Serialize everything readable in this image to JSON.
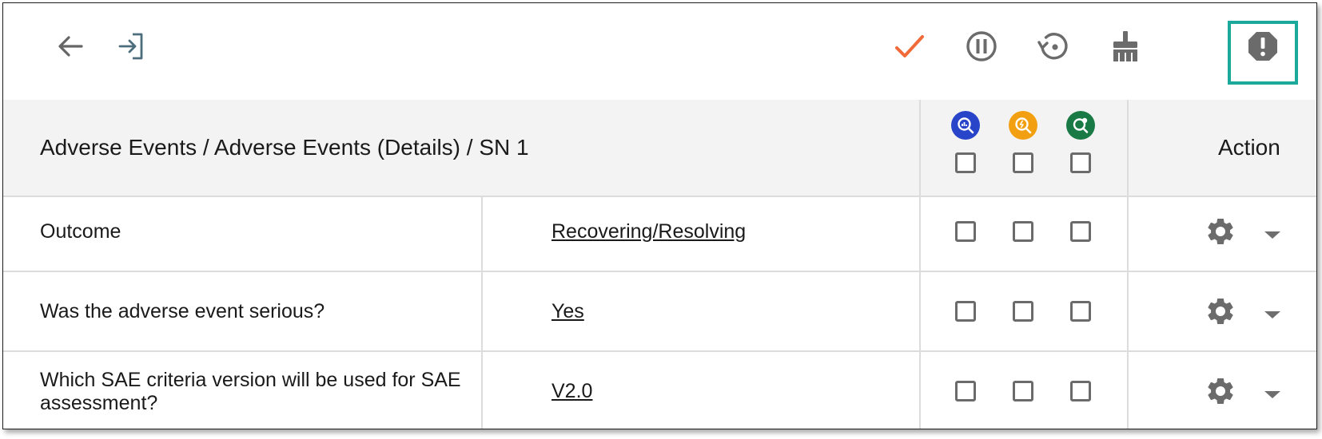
{
  "toolbar": {
    "icons": [
      "back-arrow-icon",
      "login-icon",
      "checkmark-icon",
      "pause-circle-icon",
      "restore-icon",
      "broom-icon",
      "alert-octagon-icon"
    ],
    "check_color": "#f06a3a",
    "highlight_color": "#1aa99a"
  },
  "table": {
    "breadcrumb": "Adverse Events / Adverse Events (Details) / SN 1",
    "action_label": "Action",
    "badge_colors": [
      "#2844c8",
      "#f2a011",
      "#1a7a45"
    ],
    "rows": [
      {
        "question": "Outcome",
        "answer": "Recovering/Resolving"
      },
      {
        "question": "Was the adverse event serious?",
        "answer": "Yes"
      },
      {
        "question": "Which SAE criteria version will be used for SAE assessment?",
        "answer": "V2.0"
      }
    ]
  }
}
